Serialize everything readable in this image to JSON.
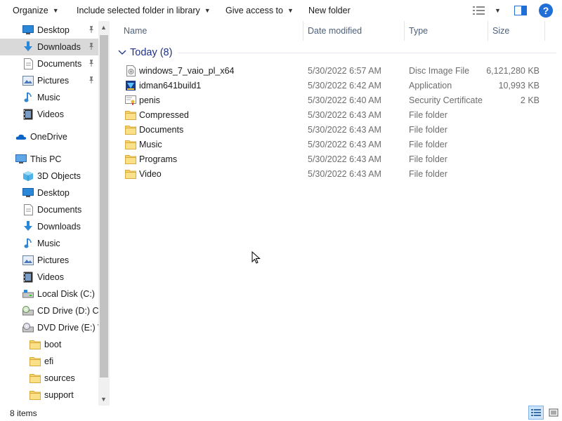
{
  "toolbar": {
    "organize": "Organize",
    "include": "Include selected folder in library",
    "give_access": "Give access to",
    "new_folder": "New folder"
  },
  "nav": {
    "quick_access": [
      {
        "label": "Desktop",
        "icon": "desktop-icon",
        "pinned": true
      },
      {
        "label": "Downloads",
        "icon": "downloads-icon",
        "pinned": true,
        "selected": true
      },
      {
        "label": "Documents",
        "icon": "documents-icon",
        "pinned": true
      },
      {
        "label": "Pictures",
        "icon": "pictures-icon",
        "pinned": true
      },
      {
        "label": "Music",
        "icon": "music-icon"
      },
      {
        "label": "Videos",
        "icon": "videos-icon"
      }
    ],
    "onedrive": "OneDrive",
    "this_pc": "This PC",
    "pc_items": [
      {
        "label": "3D Objects",
        "icon": "3d-objects-icon"
      },
      {
        "label": "Desktop",
        "icon": "desktop-icon"
      },
      {
        "label": "Documents",
        "icon": "documents-icon"
      },
      {
        "label": "Downloads",
        "icon": "downloads-icon"
      },
      {
        "label": "Music",
        "icon": "music-icon"
      },
      {
        "label": "Pictures",
        "icon": "pictures-icon"
      },
      {
        "label": "Videos",
        "icon": "videos-icon"
      },
      {
        "label": "Local Disk (C:)",
        "icon": "local-disk-icon"
      },
      {
        "label": "CD Drive (D:) CP",
        "icon": "cd-drive-icon"
      },
      {
        "label": "DVD Drive (E:) W",
        "icon": "dvd-drive-icon"
      }
    ],
    "dvd_folders": [
      "boot",
      "efi",
      "sources",
      "support"
    ]
  },
  "columns": {
    "name": "Name",
    "date": "Date modified",
    "type": "Type",
    "size": "Size"
  },
  "group": {
    "label": "Today (8)"
  },
  "files": [
    {
      "name": "windows_7_vaio_pl_x64",
      "date": "5/30/2022 6:57 AM",
      "type": "Disc Image File",
      "size": "6,121,280 KB",
      "icon": "disc-image-icon"
    },
    {
      "name": "idman641build1",
      "date": "5/30/2022 6:42 AM",
      "type": "Application",
      "size": "10,993 KB",
      "icon": "application-icon"
    },
    {
      "name": "penis",
      "date": "5/30/2022 6:40 AM",
      "type": "Security Certificate",
      "size": "2 KB",
      "icon": "certificate-icon"
    },
    {
      "name": "Compressed",
      "date": "5/30/2022 6:43 AM",
      "type": "File folder",
      "size": "",
      "icon": "folder-icon"
    },
    {
      "name": "Documents",
      "date": "5/30/2022 6:43 AM",
      "type": "File folder",
      "size": "",
      "icon": "folder-icon"
    },
    {
      "name": "Music",
      "date": "5/30/2022 6:43 AM",
      "type": "File folder",
      "size": "",
      "icon": "folder-icon"
    },
    {
      "name": "Programs",
      "date": "5/30/2022 6:43 AM",
      "type": "File folder",
      "size": "",
      "icon": "folder-icon"
    },
    {
      "name": "Video",
      "date": "5/30/2022 6:43 AM",
      "type": "File folder",
      "size": "",
      "icon": "folder-icon"
    }
  ],
  "status": {
    "items": "8 items"
  },
  "colors": {
    "accent": "#1f6fd6",
    "group_header": "#1e3287",
    "selected_bg": "#d9d9d9",
    "folder": "#f6d36b"
  }
}
